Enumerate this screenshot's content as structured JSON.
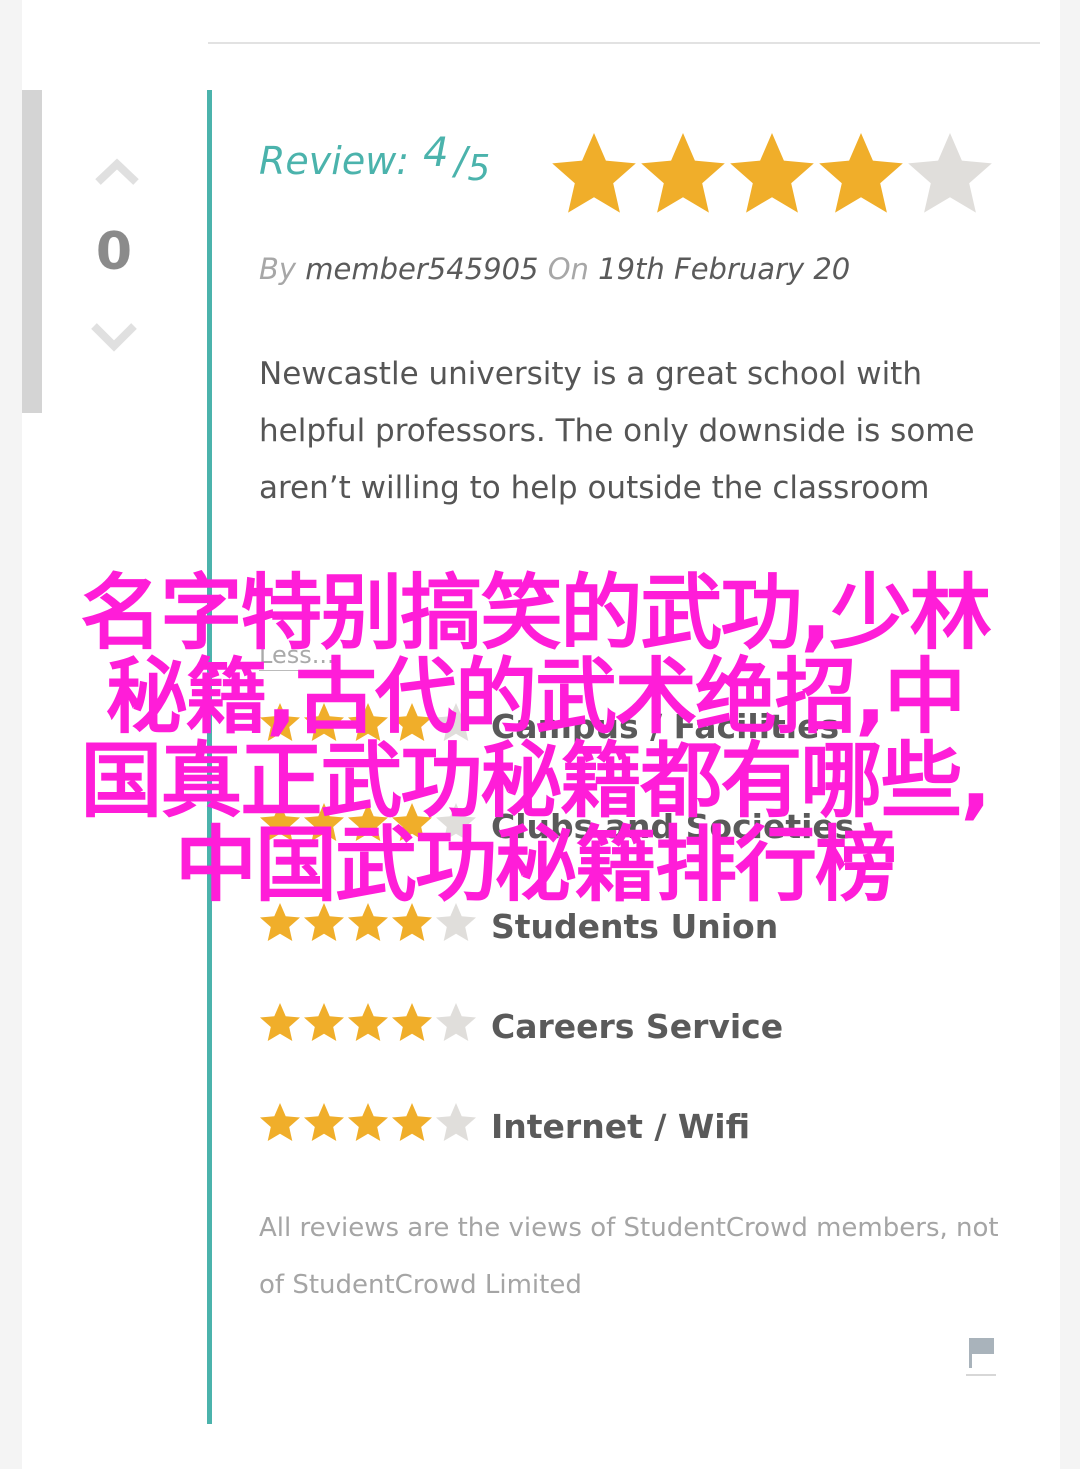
{
  "vote": {
    "count": "0",
    "up_icon": "chevron-up-icon",
    "down_icon": "chevron-down-icon"
  },
  "review": {
    "label": "Review:",
    "score": "4",
    "slash": "/",
    "max": "5",
    "stars_filled": 4,
    "stars_total": 5,
    "by_prefix": "By",
    "author": "member545905",
    "on_prefix": "On",
    "date": "19th February 20",
    "body": "Newcastle university is a great school with helpful professors. The only downside is some aren’t willing to help outside the classroom",
    "less_link": "Less..."
  },
  "ratings": [
    {
      "label": "Campus / Facilities",
      "stars": 4
    },
    {
      "label": "Clubs and Societies",
      "stars": 4
    },
    {
      "label": "Students Union",
      "stars": 4
    },
    {
      "label": "Careers Service",
      "stars": 4
    },
    {
      "label": "Internet / Wifi",
      "stars": 4
    }
  ],
  "disclaimer": "All reviews are the views of StudentCrowd members, not of StudentCrowd Limited",
  "flag_icon": "flag-icon",
  "overlay": {
    "line1": "名字特别搞笑的武功,少林",
    "line2": "秘籍,古代的武术绝招,中",
    "line3": "国真正武功秘籍都有哪些,",
    "line4": "中国武功秘籍排行榜"
  },
  "colors": {
    "teal": "#4bb3ac",
    "star_filled": "#f0ae2a",
    "star_empty": "#e0dedb",
    "overlay_text": "#ff1dd8"
  }
}
